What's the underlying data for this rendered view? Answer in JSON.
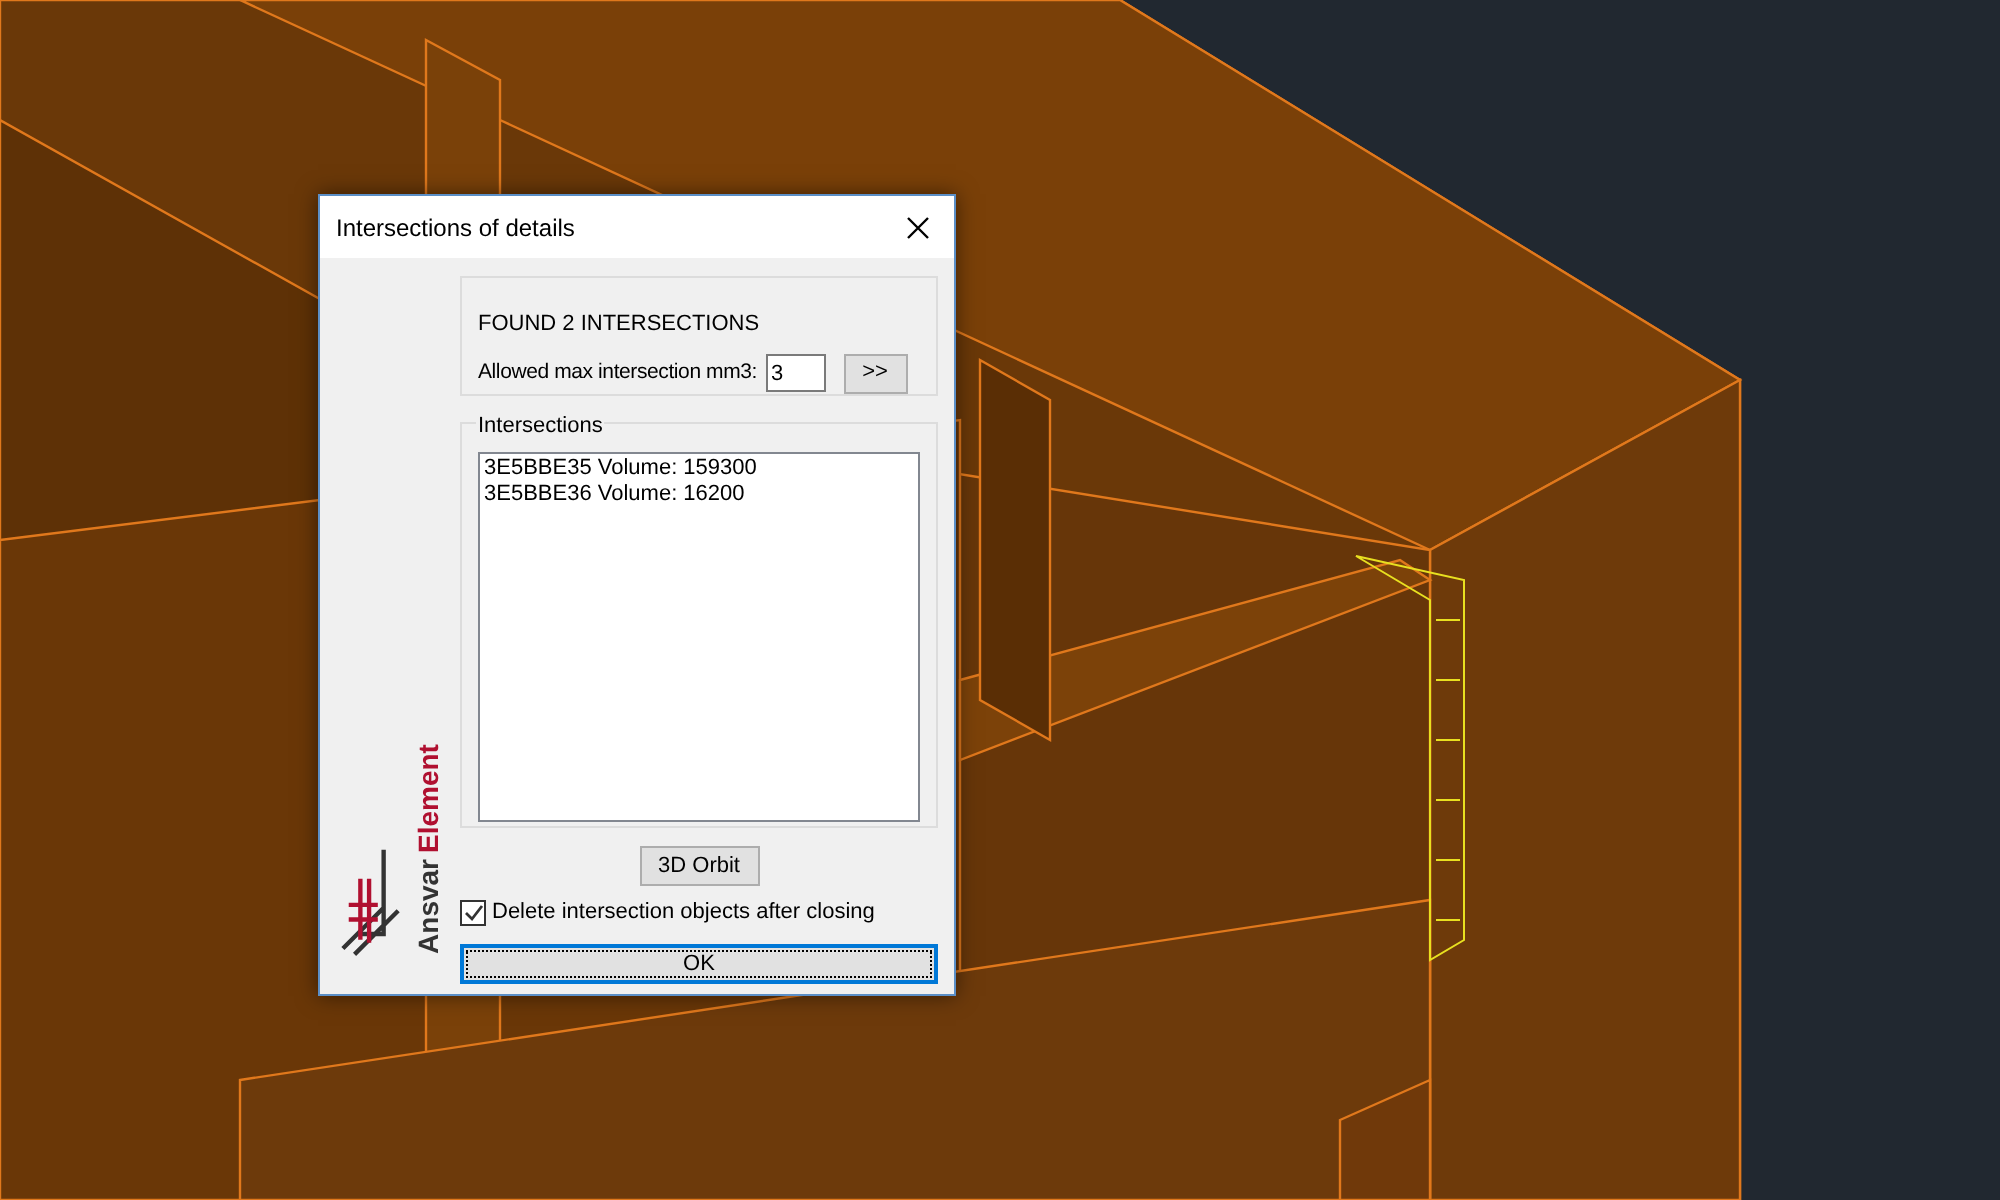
{
  "dialog": {
    "title": "Intersections of details",
    "summary": "FOUND 2 INTERSECTIONS",
    "threshold": {
      "label": "Allowed max intersection mm3:",
      "value": "3",
      "button": ">>"
    },
    "intersections": {
      "title": "Intersections",
      "items": [
        {
          "text": "3E5BBE35 Volume: 159300",
          "selected": false
        },
        {
          "text": "3E5BBE36 Volume: 16200",
          "selected": false
        }
      ]
    },
    "orbit_button": "3D Orbit",
    "delete_option": {
      "label": "Delete intersection objects after closing",
      "checked": true
    },
    "ok_button": "OK",
    "logo": {
      "word_1": "Ansvar",
      "word_2": "Element"
    }
  }
}
